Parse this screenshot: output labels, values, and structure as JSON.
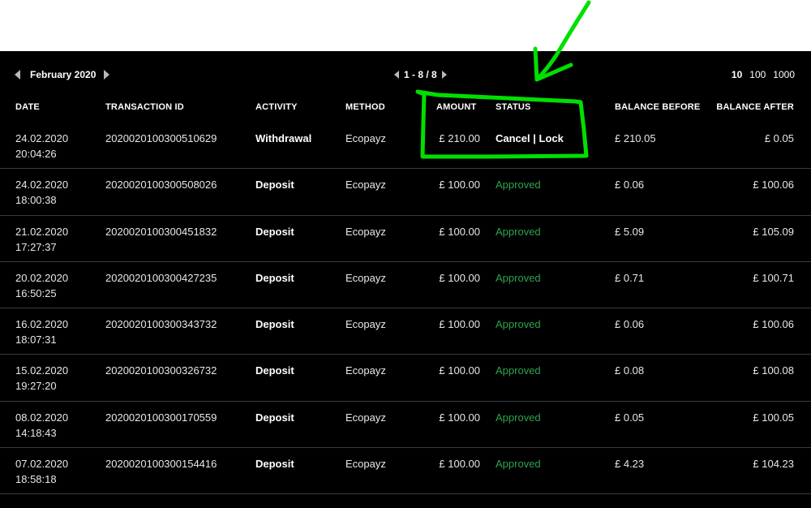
{
  "toolbar": {
    "month": "February 2020",
    "pagination": "1 - 8 / 8",
    "page_sizes": [
      "10",
      "100",
      "1000"
    ]
  },
  "columns": {
    "date": "DATE",
    "transaction_id": "TRANSACTION ID",
    "activity": "ACTIVITY",
    "method": "METHOD",
    "amount": "AMOUNT",
    "status": "STATUS",
    "balance_before": "BALANCE BEFORE",
    "balance_after": "BALANCE AFTER"
  },
  "rows": [
    {
      "date": "24.02.2020",
      "time": "20:04:26",
      "id": "2020020100300510629",
      "activity": "Withdrawal",
      "method": "Ecopayz",
      "amount": "£ 210.00",
      "status": "Cancel | Lock",
      "cancel": "Cancel",
      "sep": " | ",
      "lock": "Lock",
      "before": "£ 210.05",
      "after": "£ 0.05"
    },
    {
      "date": "24.02.2020",
      "time": "18:00:38",
      "id": "2020020100300508026",
      "activity": "Deposit",
      "method": "Ecopayz",
      "amount": "£ 100.00",
      "status": "Approved",
      "before": "£ 0.06",
      "after": "£ 100.06"
    },
    {
      "date": "21.02.2020",
      "time": "17:27:37",
      "id": "2020020100300451832",
      "activity": "Deposit",
      "method": "Ecopayz",
      "amount": "£ 100.00",
      "status": "Approved",
      "before": "£ 5.09",
      "after": "£ 105.09"
    },
    {
      "date": "20.02.2020",
      "time": "16:50:25",
      "id": "2020020100300427235",
      "activity": "Deposit",
      "method": "Ecopayz",
      "amount": "£ 100.00",
      "status": "Approved",
      "before": "£ 0.71",
      "after": "£ 100.71"
    },
    {
      "date": "16.02.2020",
      "time": "18:07:31",
      "id": "2020020100300343732",
      "activity": "Deposit",
      "method": "Ecopayz",
      "amount": "£ 100.00",
      "status": "Approved",
      "before": "£ 0.06",
      "after": "£ 100.06"
    },
    {
      "date": "15.02.2020",
      "time": "19:27:20",
      "id": "2020020100300326732",
      "activity": "Deposit",
      "method": "Ecopayz",
      "amount": "£ 100.00",
      "status": "Approved",
      "before": "£ 0.08",
      "after": "£ 100.08"
    },
    {
      "date": "08.02.2020",
      "time": "14:18:43",
      "id": "2020020100300170559",
      "activity": "Deposit",
      "method": "Ecopayz",
      "amount": "£ 100.00",
      "status": "Approved",
      "before": "£ 0.05",
      "after": "£ 100.05"
    },
    {
      "date": "07.02.2020",
      "time": "18:58:18",
      "id": "2020020100300154416",
      "activity": "Deposit",
      "method": "Ecopayz",
      "amount": "£ 100.00",
      "status": "Approved",
      "before": "£ 4.23",
      "after": "£ 104.23"
    }
  ],
  "colors": {
    "background": "#000000",
    "approved": "#2ea44f",
    "annotation": "#00e000"
  }
}
